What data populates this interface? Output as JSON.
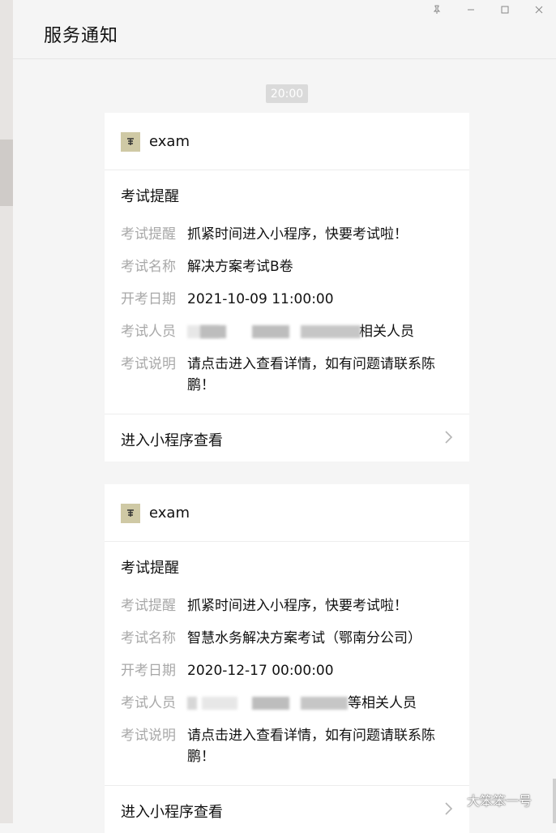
{
  "header": {
    "title": "服务通知"
  },
  "window_controls": [
    "pin-icon",
    "minimize-icon",
    "maximize-icon",
    "close-icon"
  ],
  "timestamp": "20:00",
  "cards": [
    {
      "app_name": "exam",
      "title": "考试提醒",
      "fields": [
        {
          "label": "考试提醒",
          "value": "抓紧时间进入小程序，快要考试啦！"
        },
        {
          "label": "考试名称",
          "value": "解决方案考试B卷"
        },
        {
          "label": "开考日期",
          "value": "2021-10-09 11:00:00"
        },
        {
          "label": "考试人员",
          "value_suffix": "相关人员"
        },
        {
          "label": "考试说明",
          "value": "请点击进入查看详情，如有问题请联系陈鹏！"
        }
      ],
      "footer": "进入小程序查看"
    },
    {
      "app_name": "exam",
      "title": "考试提醒",
      "fields": [
        {
          "label": "考试提醒",
          "value": "抓紧时间进入小程序，快要考试啦！"
        },
        {
          "label": "考试名称",
          "value": "智慧水务解决方案考试（鄂南分公司）"
        },
        {
          "label": "开考日期",
          "value": "2020-12-17 00:00:00"
        },
        {
          "label": "考试人员",
          "value_suffix": "等相关人员"
        },
        {
          "label": "考试说明",
          "value": "请点击进入查看详情，如有问题请联系陈鹏！"
        }
      ],
      "footer": "进入小程序查看"
    }
  ],
  "watermark": "大笨笨一号",
  "colors": {
    "background": "#f5f5f5",
    "card": "#ffffff",
    "label": "#a8a8a8",
    "timestamp_bg": "#dadada"
  }
}
